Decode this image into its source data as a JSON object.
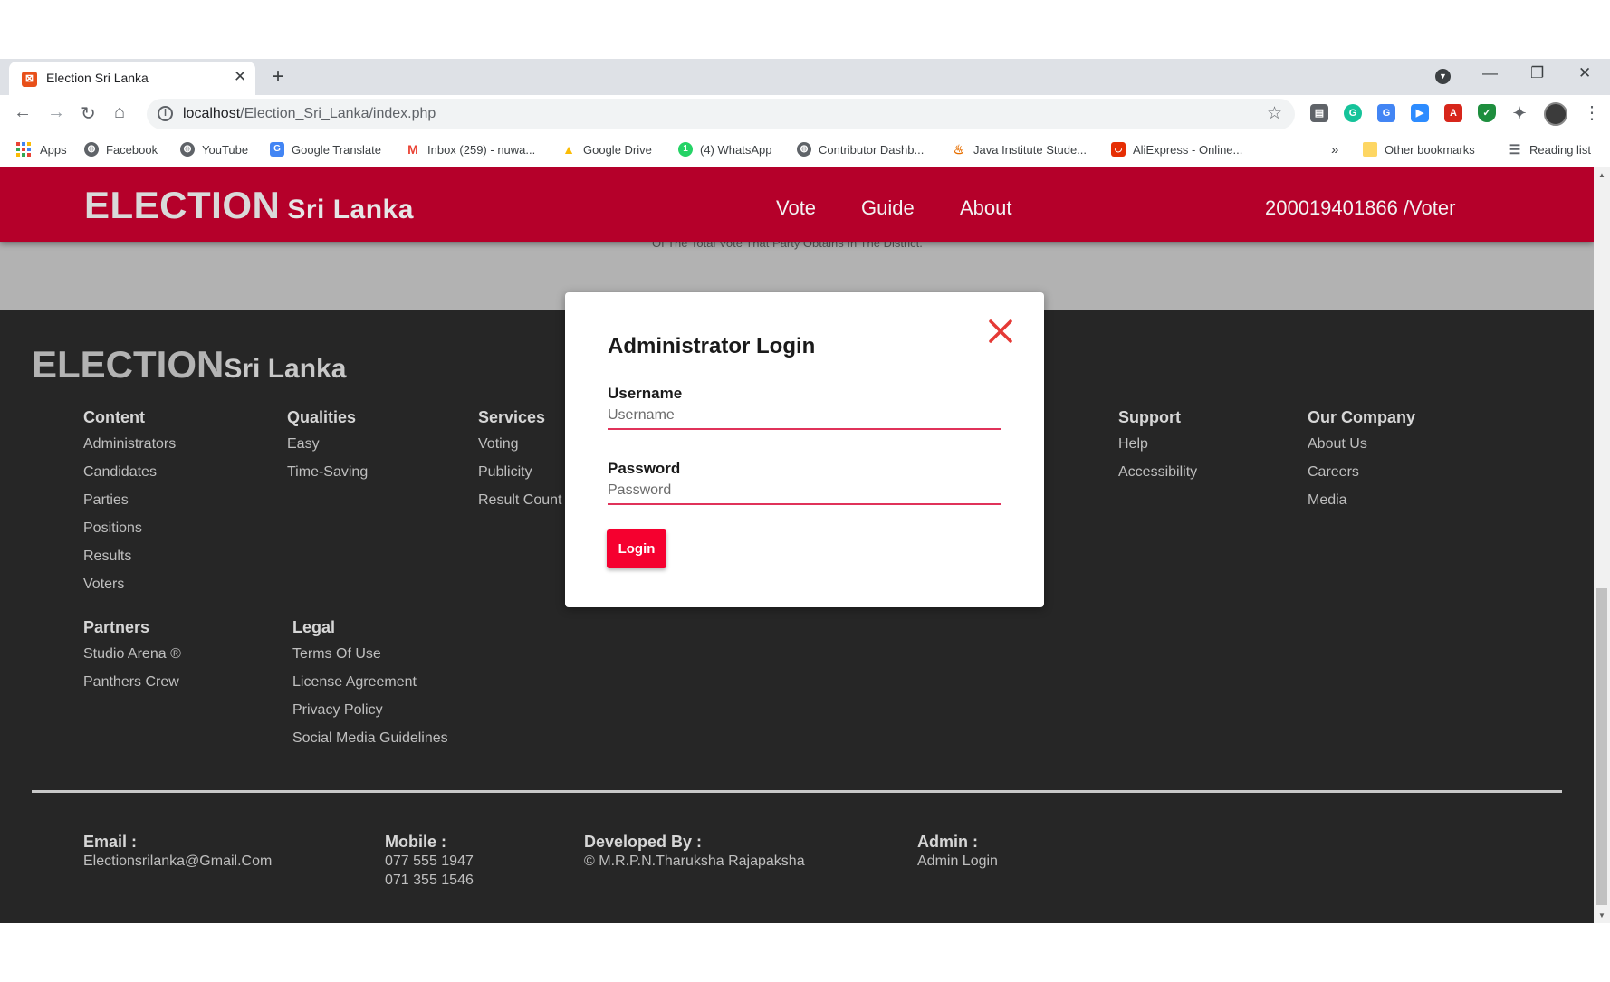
{
  "browser": {
    "tab_title": "Election Sri Lanka",
    "tab_favicon": "xampp-icon",
    "new_tab": "+",
    "url_host": "localhost",
    "url_path": "/Election_Sri_Lanka/index.php",
    "bookmarks": [
      {
        "label": "Apps",
        "icon": "apps-grid-icon"
      },
      {
        "label": "Facebook",
        "icon": "globe-icon"
      },
      {
        "label": "YouTube",
        "icon": "globe-icon"
      },
      {
        "label": "Google Translate",
        "icon": "translate-icon"
      },
      {
        "label": "Inbox (259) - nuwa...",
        "icon": "gmail-icon"
      },
      {
        "label": "Google Drive",
        "icon": "drive-icon"
      },
      {
        "label": "(4) WhatsApp",
        "icon": "whatsapp-icon"
      },
      {
        "label": "Contributor Dashb...",
        "icon": "globe-icon"
      },
      {
        "label": "Java Institute Stude...",
        "icon": "java-icon"
      },
      {
        "label": "AliExpress - Online...",
        "icon": "aliexpress-icon"
      }
    ],
    "bookmarks_more": "»",
    "other_bookmarks": "Other bookmarks",
    "reading_list": "Reading list"
  },
  "header": {
    "logo_big": "ELECTION",
    "logo_small": "Sri Lanka",
    "nav": [
      "Vote",
      "Guide",
      "About"
    ],
    "user": "200019401866 /Voter"
  },
  "background_text": "Of The Total Vote That Party Obtains In The District.",
  "footer": {
    "logo_big": "ELECTION",
    "logo_small": "Sri Lanka",
    "columns": {
      "content": {
        "head": "Content",
        "links": [
          "Administrators",
          "Candidates",
          "Parties",
          "Positions",
          "Results",
          "Voters"
        ]
      },
      "qualities": {
        "head": "Qualities",
        "links": [
          "Easy",
          "Time-Saving"
        ]
      },
      "services": {
        "head": "Services",
        "links": [
          "Voting",
          "Publicity",
          "Result Count"
        ]
      },
      "support": {
        "head": "Support",
        "links": [
          "Help",
          "Accessibility"
        ]
      },
      "company": {
        "head": "Our Company",
        "links": [
          "About Us",
          "Careers",
          "Media"
        ]
      },
      "partners": {
        "head": "Partners",
        "links": [
          "Studio Arena ®",
          "Panthers Crew"
        ]
      },
      "legal": {
        "head": "Legal",
        "links": [
          "Terms Of Use",
          "License Agreement",
          "Privacy Policy",
          "Social Media Guidelines"
        ]
      }
    },
    "email_label": "Email :",
    "email_value": "Electionsrilanka@Gmail.Com",
    "mobile_label": "Mobile :",
    "mobile_1": "077 555 1947",
    "mobile_2": "071 355 1546",
    "dev_label": "Developed By :",
    "dev_value": "© M.R.P.N.Tharuksha Rajapaksha",
    "admin_label": "Admin :",
    "admin_value": "Admin Login"
  },
  "modal": {
    "title": "Administrator Login",
    "username_label": "Username",
    "username_placeholder": "Username",
    "password_label": "Password",
    "password_placeholder": "Password",
    "login_button": "Login"
  },
  "colors": {
    "header_red": "#b5002a",
    "button_red": "#f5002f",
    "close_red": "#e53935",
    "footer_bg": "#262626"
  }
}
